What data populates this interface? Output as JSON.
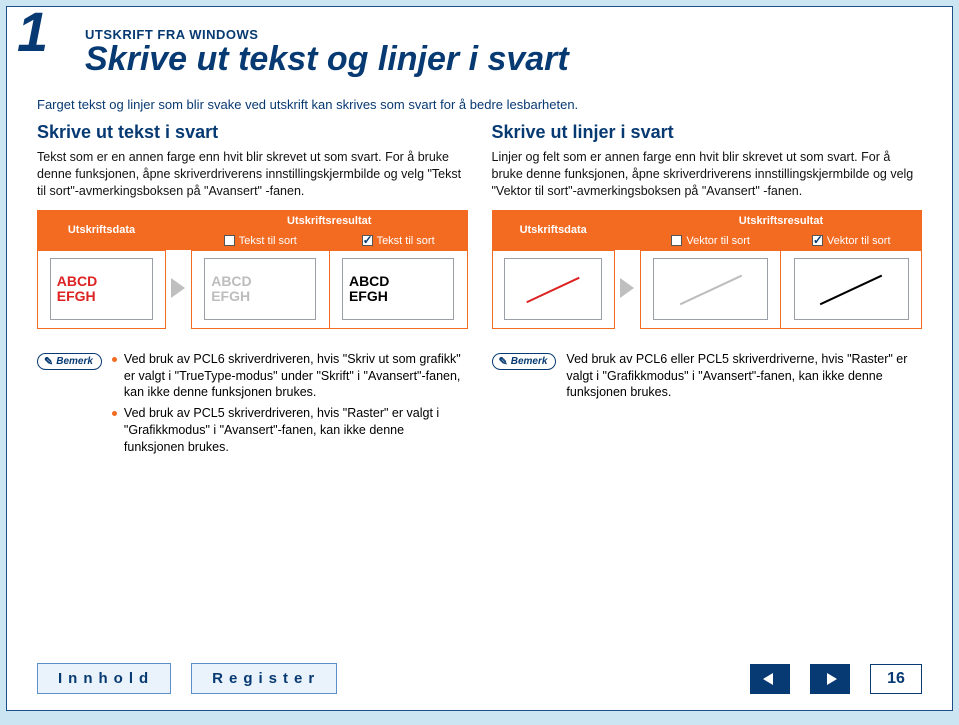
{
  "header": {
    "chapter_number": "1",
    "kicker": "UTSKRIFT FRA WINDOWS",
    "title": "Skrive ut tekst og linjer i svart"
  },
  "intro": "Farget tekst og linjer som blir svake ved utskrift kan skrives som svart for å bedre lesbarheten.",
  "left": {
    "heading": "Skrive ut tekst i svart",
    "body": "Tekst som er en annen farge enn hvit blir skrevet ut som svart. For å bruke denne funksjonen, åpne skriverdriverens innstillingskjermbilde og velg \"Tekst til sort\"-avmerkingsboksen på \"Avansert\" -fanen.",
    "table": {
      "data_label": "Utskriftsdata",
      "result_label": "Utskriftsresultat",
      "opt_off": "Tekst til sort",
      "opt_on": "Tekst til sort",
      "sample_line1": "ABCD",
      "sample_line2": "EFGH"
    },
    "note_badge": "Bemerk",
    "notes": [
      "Ved bruk av PCL6 skriverdriveren, hvis \"Skriv ut som grafikk\" er valgt i \"TrueType-modus\" under \"Skrift\" i \"Avansert\"-fanen, kan ikke denne funksjonen brukes.",
      "Ved bruk av PCL5 skriverdriveren, hvis \"Raster\" er valgt i \"Grafikkmodus\" i \"Avansert\"-fanen, kan ikke denne funksjonen brukes."
    ]
  },
  "right": {
    "heading": "Skrive ut linjer i svart",
    "body": "Linjer og felt som er annen farge enn hvit blir skrevet ut som svart. For å bruke denne funksjonen, åpne skriverdriverens innstillingskjermbilde og velg \"Vektor til sort\"-avmerkingsboksen på \"Avansert\" -fanen.",
    "table": {
      "data_label": "Utskriftsdata",
      "result_label": "Utskriftsresultat",
      "opt_off": "Vektor til sort",
      "opt_on": "Vektor til sort"
    },
    "note_badge": "Bemerk",
    "note": "Ved bruk av PCL6 eller PCL5 skriverdriverne, hvis \"Raster\" er valgt i \"Grafikkmodus\" i \"Avansert\"-fanen, kan ikke denne funksjonen brukes."
  },
  "footer": {
    "contents": "Innhold",
    "index": "Register",
    "page": "16"
  }
}
